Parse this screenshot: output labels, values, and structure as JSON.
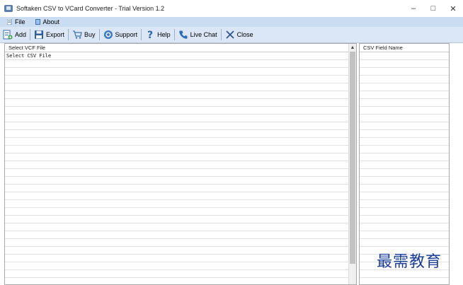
{
  "window": {
    "title": "Softaken CSV to VCard Converter - Trial Version 1.2",
    "controls": {
      "minimize": "–",
      "maximize": "□",
      "close": "✕"
    }
  },
  "menu": {
    "items": [
      {
        "label": "File",
        "icon": "file-icon"
      },
      {
        "label": "About",
        "icon": "about-icon"
      }
    ]
  },
  "toolbar": {
    "items": [
      {
        "label": "Add",
        "icon": "add-file-icon",
        "color": "#3a6db5"
      },
      {
        "label": "Export",
        "icon": "save-icon",
        "color": "#2f5f9e"
      },
      {
        "label": "Buy",
        "icon": "cart-icon",
        "color": "#3f74b8"
      },
      {
        "label": "Support",
        "icon": "support-icon",
        "color": "#3b79c8"
      },
      {
        "label": "Help",
        "icon": "question-icon",
        "color": "#2a66b2"
      },
      {
        "label": "Live Chat",
        "icon": "phone-icon",
        "color": "#2a6bb6"
      },
      {
        "label": "Close",
        "icon": "close-x-icon",
        "color": "#2a4e8c"
      }
    ]
  },
  "left_panel": {
    "header": "Select VCF File",
    "first_row_text": "Select CSV File"
  },
  "right_panel": {
    "header": "CSV Field Name"
  },
  "watermark": "最需教育",
  "colors": {
    "menubar_bg": "#c9dcf2",
    "toolbar_bg": "#dbe7f6",
    "watermark": "#1a3d9a"
  }
}
